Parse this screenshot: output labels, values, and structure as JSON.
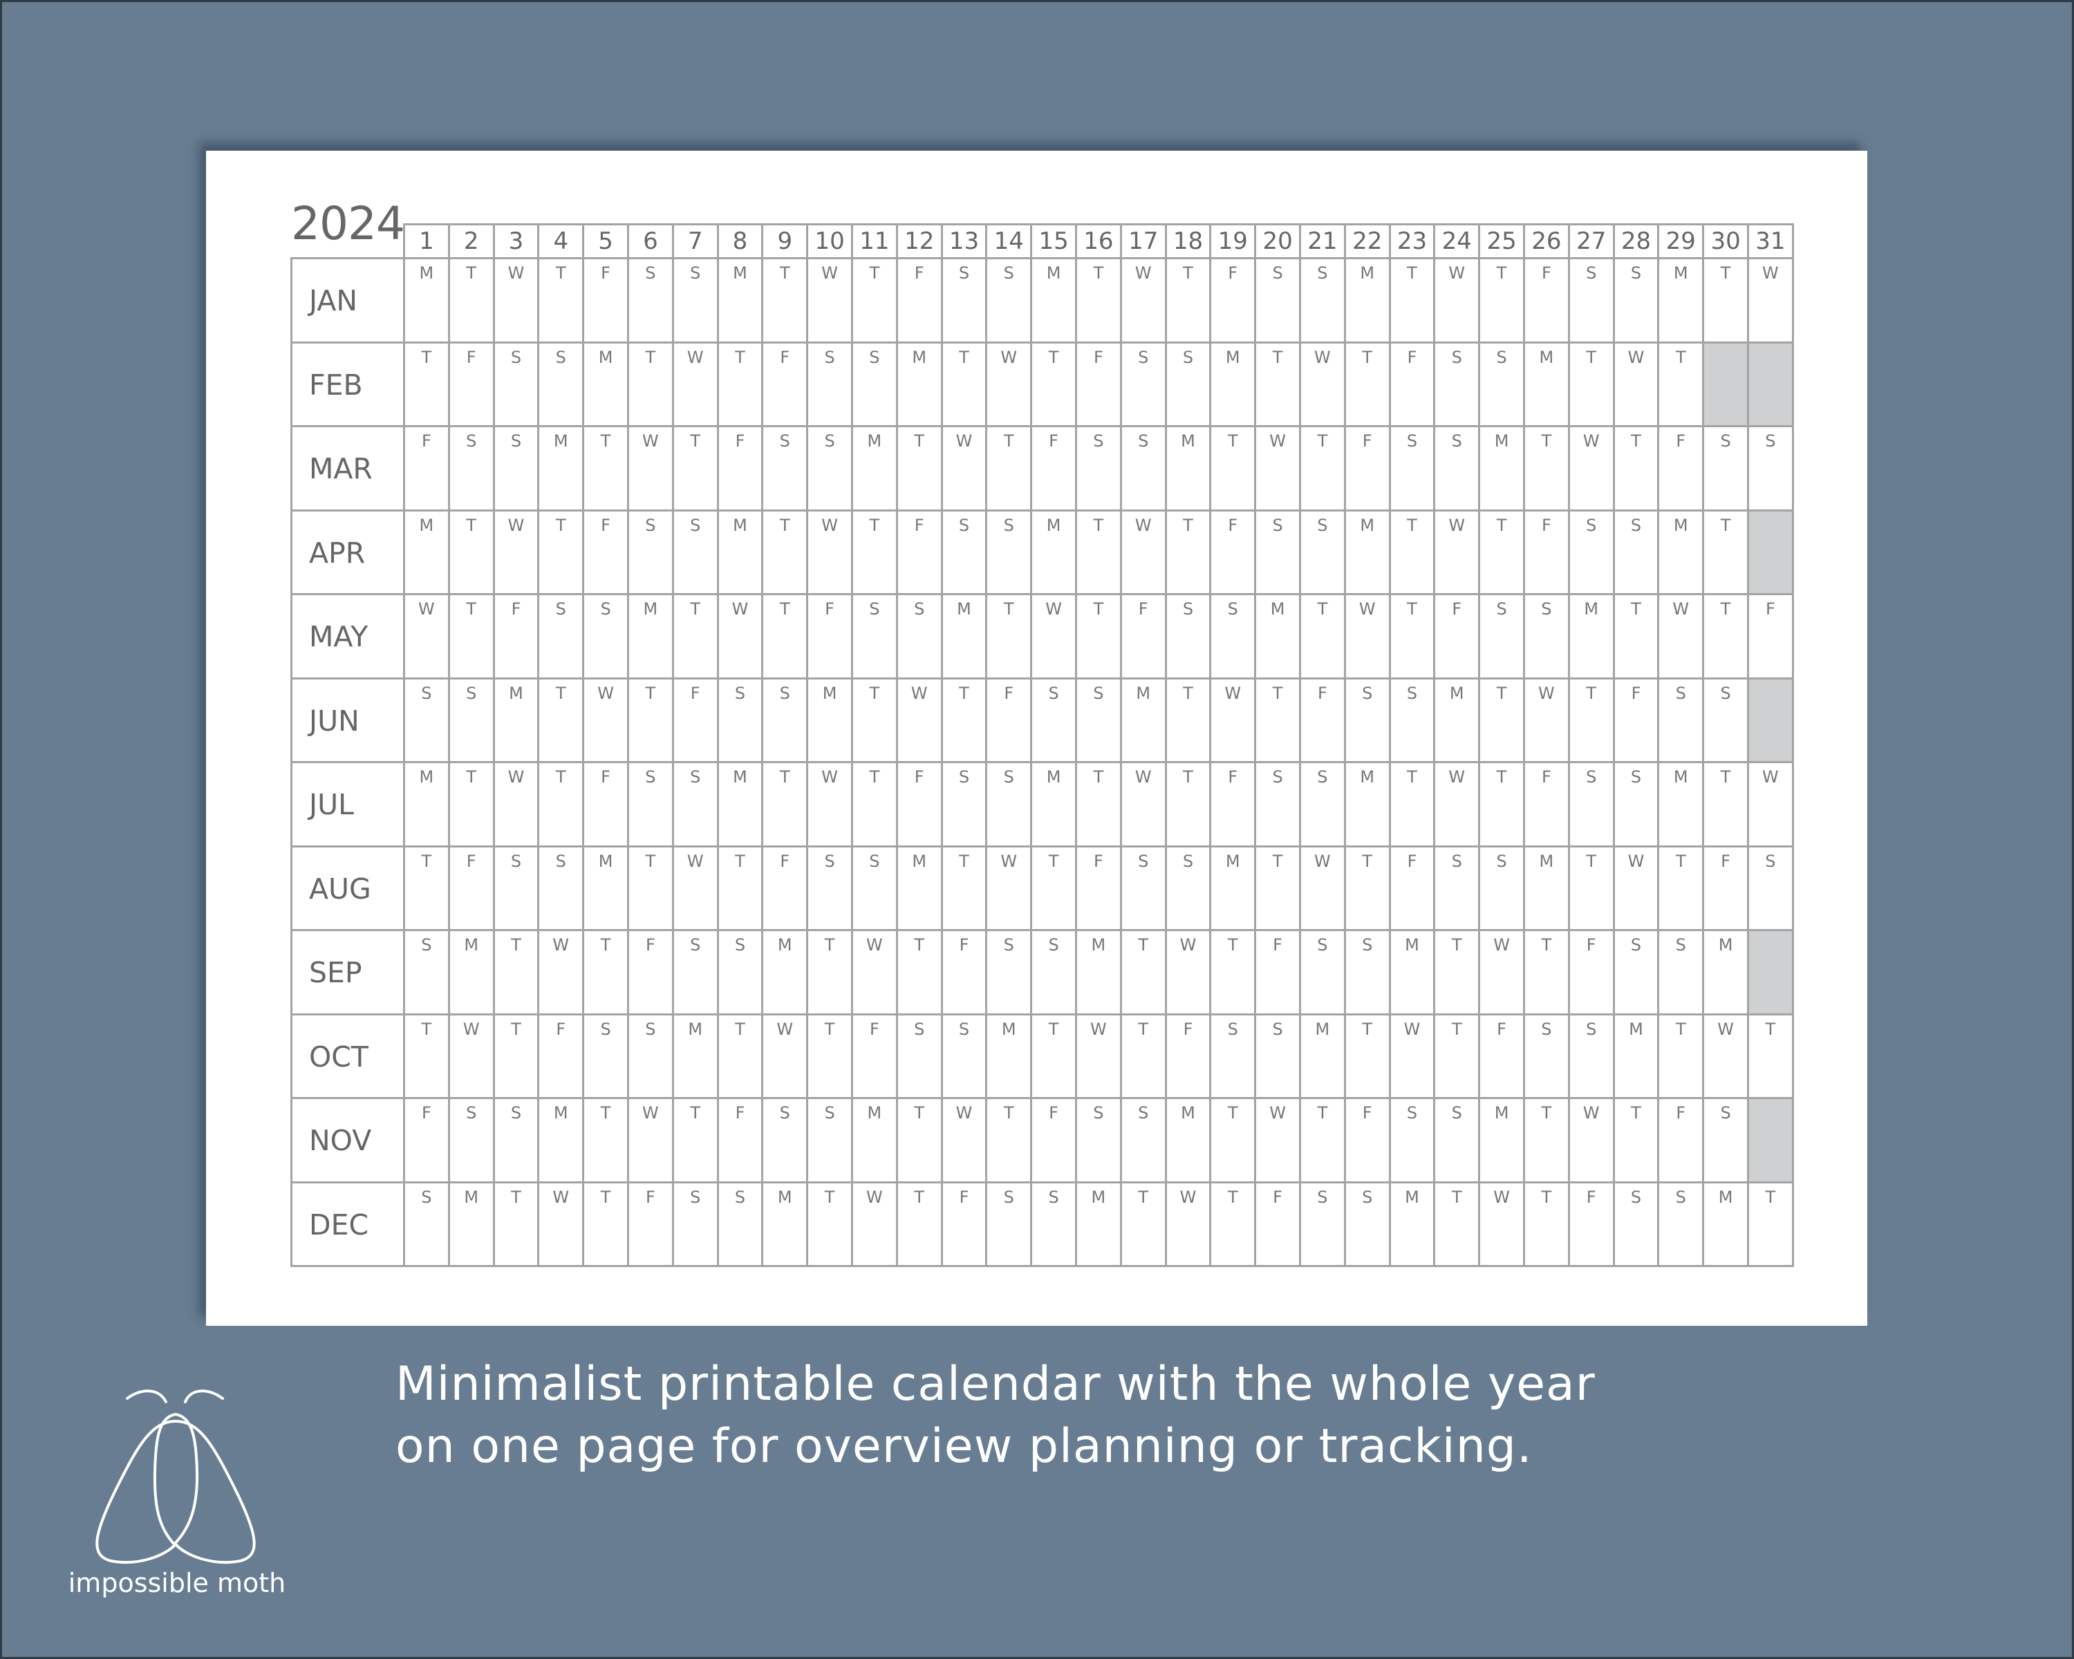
{
  "calendar": {
    "year": "2024",
    "day_numbers": [
      "1",
      "2",
      "3",
      "4",
      "5",
      "6",
      "7",
      "8",
      "9",
      "10",
      "11",
      "12",
      "13",
      "14",
      "15",
      "16",
      "17",
      "18",
      "19",
      "20",
      "21",
      "22",
      "23",
      "24",
      "25",
      "26",
      "27",
      "28",
      "29",
      "30",
      "31"
    ],
    "months": [
      {
        "label": "JAN",
        "days": [
          "M",
          "T",
          "W",
          "T",
          "F",
          "S",
          "S",
          "M",
          "T",
          "W",
          "T",
          "F",
          "S",
          "S",
          "M",
          "T",
          "W",
          "T",
          "F",
          "S",
          "S",
          "M",
          "T",
          "W",
          "T",
          "F",
          "S",
          "S",
          "M",
          "T",
          "W"
        ]
      },
      {
        "label": "FEB",
        "days": [
          "T",
          "F",
          "S",
          "S",
          "M",
          "T",
          "W",
          "T",
          "F",
          "S",
          "S",
          "M",
          "T",
          "W",
          "T",
          "F",
          "S",
          "S",
          "M",
          "T",
          "W",
          "T",
          "F",
          "S",
          "S",
          "M",
          "T",
          "W",
          "T"
        ]
      },
      {
        "label": "MAR",
        "days": [
          "F",
          "S",
          "S",
          "M",
          "T",
          "W",
          "T",
          "F",
          "S",
          "S",
          "M",
          "T",
          "W",
          "T",
          "F",
          "S",
          "S",
          "M",
          "T",
          "W",
          "T",
          "F",
          "S",
          "S",
          "M",
          "T",
          "W",
          "T",
          "F",
          "S",
          "S"
        ]
      },
      {
        "label": "APR",
        "days": [
          "M",
          "T",
          "W",
          "T",
          "F",
          "S",
          "S",
          "M",
          "T",
          "W",
          "T",
          "F",
          "S",
          "S",
          "M",
          "T",
          "W",
          "T",
          "F",
          "S",
          "S",
          "M",
          "T",
          "W",
          "T",
          "F",
          "S",
          "S",
          "M",
          "T"
        ]
      },
      {
        "label": "MAY",
        "days": [
          "W",
          "T",
          "F",
          "S",
          "S",
          "M",
          "T",
          "W",
          "T",
          "F",
          "S",
          "S",
          "M",
          "T",
          "W",
          "T",
          "F",
          "S",
          "S",
          "M",
          "T",
          "W",
          "T",
          "F",
          "S",
          "S",
          "M",
          "T",
          "W",
          "T",
          "F"
        ]
      },
      {
        "label": "JUN",
        "days": [
          "S",
          "S",
          "M",
          "T",
          "W",
          "T",
          "F",
          "S",
          "S",
          "M",
          "T",
          "W",
          "T",
          "F",
          "S",
          "S",
          "M",
          "T",
          "W",
          "T",
          "F",
          "S",
          "S",
          "M",
          "T",
          "W",
          "T",
          "F",
          "S",
          "S"
        ]
      },
      {
        "label": "JUL",
        "days": [
          "M",
          "T",
          "W",
          "T",
          "F",
          "S",
          "S",
          "M",
          "T",
          "W",
          "T",
          "F",
          "S",
          "S",
          "M",
          "T",
          "W",
          "T",
          "F",
          "S",
          "S",
          "M",
          "T",
          "W",
          "T",
          "F",
          "S",
          "S",
          "M",
          "T",
          "W"
        ]
      },
      {
        "label": "AUG",
        "days": [
          "T",
          "F",
          "S",
          "S",
          "M",
          "T",
          "W",
          "T",
          "F",
          "S",
          "S",
          "M",
          "T",
          "W",
          "T",
          "F",
          "S",
          "S",
          "M",
          "T",
          "W",
          "T",
          "F",
          "S",
          "S",
          "M",
          "T",
          "W",
          "T",
          "F",
          "S"
        ]
      },
      {
        "label": "SEP",
        "days": [
          "S",
          "M",
          "T",
          "W",
          "T",
          "F",
          "S",
          "S",
          "M",
          "T",
          "W",
          "T",
          "F",
          "S",
          "S",
          "M",
          "T",
          "W",
          "T",
          "F",
          "S",
          "S",
          "M",
          "T",
          "W",
          "T",
          "F",
          "S",
          "S",
          "M"
        ]
      },
      {
        "label": "OCT",
        "days": [
          "T",
          "W",
          "T",
          "F",
          "S",
          "S",
          "M",
          "T",
          "W",
          "T",
          "F",
          "S",
          "S",
          "M",
          "T",
          "W",
          "T",
          "F",
          "S",
          "S",
          "M",
          "T",
          "W",
          "T",
          "F",
          "S",
          "S",
          "M",
          "T",
          "W",
          "T"
        ]
      },
      {
        "label": "NOV",
        "days": [
          "F",
          "S",
          "S",
          "M",
          "T",
          "W",
          "T",
          "F",
          "S",
          "S",
          "M",
          "T",
          "W",
          "T",
          "F",
          "S",
          "S",
          "M",
          "T",
          "W",
          "T",
          "F",
          "S",
          "S",
          "M",
          "T",
          "W",
          "T",
          "F",
          "S"
        ]
      },
      {
        "label": "DEC",
        "days": [
          "S",
          "M",
          "T",
          "W",
          "T",
          "F",
          "S",
          "S",
          "M",
          "T",
          "W",
          "T",
          "F",
          "S",
          "S",
          "M",
          "T",
          "W",
          "T",
          "F",
          "S",
          "S",
          "M",
          "T",
          "W",
          "T",
          "F",
          "S",
          "S",
          "M",
          "T"
        ]
      }
    ]
  },
  "caption": {
    "line1": "Minimalist printable calendar with the whole year",
    "line2": "on one page for overview planning or tracking."
  },
  "brand": {
    "name": "impossible moth",
    "icon": "moth-logo-icon"
  },
  "colors": {
    "background": "#687d92",
    "paper": "#ffffff",
    "grid_line": "#a3a3a3",
    "text": "#666666",
    "unused_day": "#cfd0d2"
  }
}
